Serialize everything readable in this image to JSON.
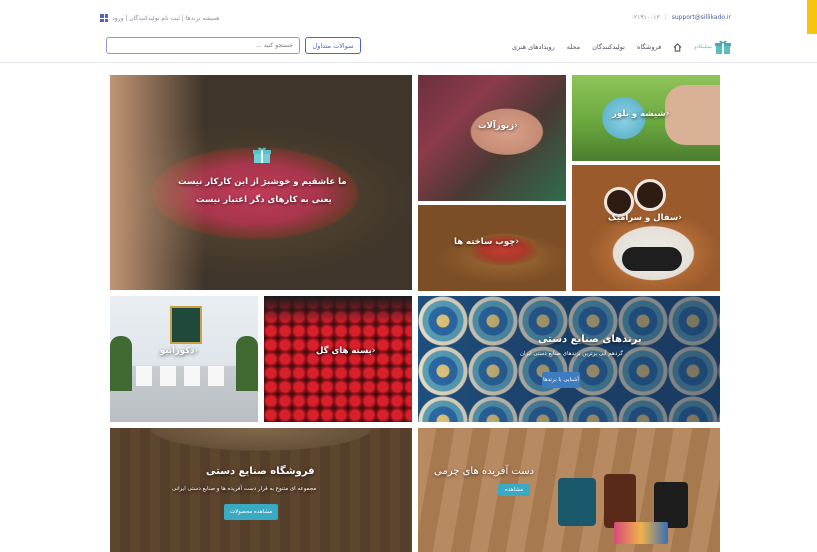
{
  "header": {
    "email": "support@sillikado.ir",
    "phone": "۰۲۱۹۱۰۰۱۳",
    "util_links": "همیشه برندها | ثبت نام تولیدکنندگان | ورود",
    "faq_label": "سوالات متداول",
    "search_placeholder": "جستجو کنید ...",
    "nav": [
      {
        "label": "فروشگاه"
      },
      {
        "label": "تولیدکنندگان"
      },
      {
        "label": "مجله"
      },
      {
        "label": "رویدادهای هنری"
      }
    ],
    "logo_text": "سیلیکادو"
  },
  "tiles": {
    "hero": {
      "line1": "ما عاشقیم و خوشبرَ از این کارکار نیست",
      "line2": "یعنی به کارهای دگر اعتبار نیست"
    },
    "jewelry": {
      "label": "زیورآلات"
    },
    "glass": {
      "label": "شیشه و بلور"
    },
    "wood": {
      "label": "چوب ساخته ها"
    },
    "ceramic": {
      "label": "سفال و سرامیک"
    },
    "decor": {
      "label": "دکوراتیو"
    },
    "flowers": {
      "label": "بسته های گل"
    },
    "brands": {
      "title": "برندهای صنایع دستی",
      "subtitle": "گردهم آیی برترین برندهای صنایع دستی ایران",
      "button": "آشنایی با برندها"
    },
    "shop": {
      "title": "فروشگاه صنایع دستی",
      "subtitle": "مجموعه ای متنوع به قرار دست آفریده ها و صنایع دستی ایرانی",
      "button": "مشاهده محصولات"
    },
    "leather": {
      "title": "دست آفریده های چرمی",
      "button": "مشاهده"
    }
  },
  "colors": {
    "accent": "#4f64c8",
    "teal": "#3aa9c2",
    "corner": "#f6c40f"
  }
}
